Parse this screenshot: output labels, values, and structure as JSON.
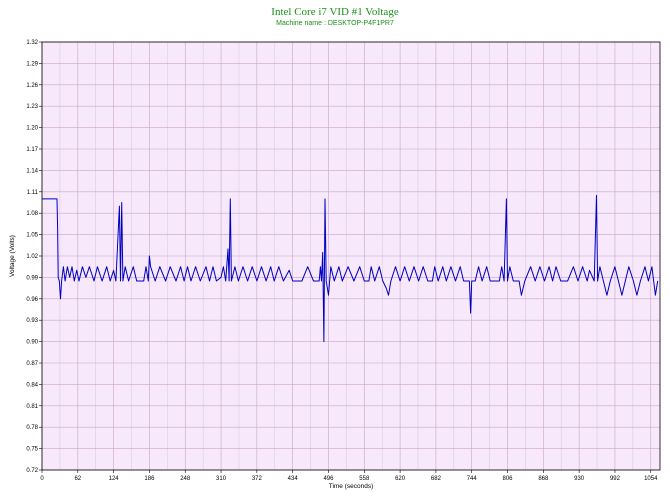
{
  "chart_data": {
    "type": "line",
    "title": "Intel Core i7 VID #1 Voltage",
    "subtitle": "Machine name : DESKTOP-P4F1PR7",
    "xlabel": "Time (seconds)",
    "ylabel": "Voltage (Volts)",
    "xlim": [
      0,
      1070
    ],
    "ylim": [
      0.72,
      1.32
    ],
    "x_ticks": [
      0,
      62,
      124,
      186,
      248,
      310,
      372,
      434,
      496,
      558,
      620,
      682,
      744,
      806,
      868,
      930,
      992,
      1054
    ],
    "y_ticks": [
      0.72,
      0.75,
      0.78,
      0.81,
      0.84,
      0.87,
      0.9,
      0.93,
      0.96,
      0.99,
      1.02,
      1.05,
      1.08,
      1.11,
      1.14,
      1.17,
      1.2,
      1.23,
      1.26,
      1.29,
      1.32
    ],
    "grid": true,
    "colors": {
      "line": "#0000c0",
      "plot_bg": "#f7e8fb",
      "grid": "#c9a6c9",
      "title": "#1a8f1a"
    },
    "series": [
      {
        "values": [
          [
            0,
            1.1
          ],
          [
            26,
            1.1
          ],
          [
            27,
            1.06
          ],
          [
            28,
            0.99
          ],
          [
            30,
            0.985
          ],
          [
            32,
            0.96
          ],
          [
            34,
            0.985
          ],
          [
            37,
            1.005
          ],
          [
            40,
            0.985
          ],
          [
            44,
            1.005
          ],
          [
            48,
            0.99
          ],
          [
            52,
            1.005
          ],
          [
            56,
            0.985
          ],
          [
            60,
            1.0
          ],
          [
            64,
            0.985
          ],
          [
            70,
            1.005
          ],
          [
            76,
            0.99
          ],
          [
            82,
            1.005
          ],
          [
            90,
            0.985
          ],
          [
            96,
            1.005
          ],
          [
            104,
            0.985
          ],
          [
            112,
            1.005
          ],
          [
            118,
            0.985
          ],
          [
            124,
            1.0
          ],
          [
            128,
            0.985
          ],
          [
            134,
            1.09
          ],
          [
            136,
            0.985
          ],
          [
            138,
            1.095
          ],
          [
            140,
            0.985
          ],
          [
            144,
            1.005
          ],
          [
            150,
            0.985
          ],
          [
            158,
            1.005
          ],
          [
            164,
            0.985
          ],
          [
            176,
            0.985
          ],
          [
            180,
            1.005
          ],
          [
            184,
            0.985
          ],
          [
            186,
            1.02
          ],
          [
            188,
            1.005
          ],
          [
            196,
            0.985
          ],
          [
            204,
            1.005
          ],
          [
            214,
            0.985
          ],
          [
            222,
            1.005
          ],
          [
            232,
            0.985
          ],
          [
            240,
            1.005
          ],
          [
            246,
            0.985
          ],
          [
            252,
            1.005
          ],
          [
            258,
            0.985
          ],
          [
            266,
            1.005
          ],
          [
            274,
            0.985
          ],
          [
            284,
            1.005
          ],
          [
            290,
            0.985
          ],
          [
            296,
            1.005
          ],
          [
            302,
            0.985
          ],
          [
            310,
            0.99
          ],
          [
            314,
            1.005
          ],
          [
            318,
            0.985
          ],
          [
            322,
            1.03
          ],
          [
            324,
            0.985
          ],
          [
            326,
            1.1
          ],
          [
            328,
            0.985
          ],
          [
            334,
            1.005
          ],
          [
            340,
            0.985
          ],
          [
            348,
            1.005
          ],
          [
            356,
            0.985
          ],
          [
            364,
            1.005
          ],
          [
            372,
            0.985
          ],
          [
            380,
            1.005
          ],
          [
            388,
            0.985
          ],
          [
            396,
            1.005
          ],
          [
            402,
            0.985
          ],
          [
            410,
            1.005
          ],
          [
            418,
            0.985
          ],
          [
            428,
            1.0
          ],
          [
            434,
            0.985
          ],
          [
            450,
            0.985
          ],
          [
            460,
            1.005
          ],
          [
            470,
            0.985
          ],
          [
            480,
            0.985
          ],
          [
            482,
            1.005
          ],
          [
            484,
            0.985
          ],
          [
            486,
            1.025
          ],
          [
            488,
            0.9
          ],
          [
            490,
            1.1
          ],
          [
            492,
            0.985
          ],
          [
            496,
            0.965
          ],
          [
            500,
            1.005
          ],
          [
            506,
            0.985
          ],
          [
            514,
            1.005
          ],
          [
            520,
            0.985
          ],
          [
            530,
            1.005
          ],
          [
            540,
            0.985
          ],
          [
            550,
            1.005
          ],
          [
            558,
            0.985
          ],
          [
            566,
            0.985
          ],
          [
            570,
            1.005
          ],
          [
            576,
            0.985
          ],
          [
            584,
            1.005
          ],
          [
            590,
            0.985
          ],
          [
            596,
            0.975
          ],
          [
            600,
            0.965
          ],
          [
            604,
            0.985
          ],
          [
            612,
            1.005
          ],
          [
            620,
            0.985
          ],
          [
            628,
            1.005
          ],
          [
            636,
            0.985
          ],
          [
            644,
            1.005
          ],
          [
            652,
            0.985
          ],
          [
            660,
            1.005
          ],
          [
            668,
            0.985
          ],
          [
            676,
            0.985
          ],
          [
            680,
            1.005
          ],
          [
            686,
            0.985
          ],
          [
            694,
            1.005
          ],
          [
            700,
            0.985
          ],
          [
            708,
            1.005
          ],
          [
            716,
            0.985
          ],
          [
            724,
            1.005
          ],
          [
            730,
            0.985
          ],
          [
            740,
            0.985
          ],
          [
            742,
            0.94
          ],
          [
            744,
            0.985
          ],
          [
            750,
            0.985
          ],
          [
            756,
            1.005
          ],
          [
            762,
            0.985
          ],
          [
            770,
            1.005
          ],
          [
            776,
            0.985
          ],
          [
            792,
            0.985
          ],
          [
            796,
            1.005
          ],
          [
            800,
            0.985
          ],
          [
            804,
            1.1
          ],
          [
            806,
            0.985
          ],
          [
            810,
            1.005
          ],
          [
            816,
            0.985
          ],
          [
            826,
            0.985
          ],
          [
            830,
            0.965
          ],
          [
            836,
            0.985
          ],
          [
            846,
            1.005
          ],
          [
            854,
            0.985
          ],
          [
            862,
            1.005
          ],
          [
            870,
            0.985
          ],
          [
            878,
            1.005
          ],
          [
            884,
            0.985
          ],
          [
            890,
            1.005
          ],
          [
            898,
            0.985
          ],
          [
            910,
            0.985
          ],
          [
            920,
            1.005
          ],
          [
            928,
            0.985
          ],
          [
            936,
            1.005
          ],
          [
            944,
            0.985
          ],
          [
            948,
            1.0
          ],
          [
            956,
            0.985
          ],
          [
            960,
            1.105
          ],
          [
            962,
            0.985
          ],
          [
            966,
            1.005
          ],
          [
            972,
            0.985
          ],
          [
            978,
            0.965
          ],
          [
            984,
            0.985
          ],
          [
            992,
            1.005
          ],
          [
            998,
            0.985
          ],
          [
            1004,
            0.965
          ],
          [
            1010,
            0.985
          ],
          [
            1016,
            1.005
          ],
          [
            1024,
            0.985
          ],
          [
            1030,
            0.965
          ],
          [
            1036,
            0.985
          ],
          [
            1044,
            1.005
          ],
          [
            1050,
            0.985
          ],
          [
            1056,
            1.005
          ],
          [
            1062,
            0.965
          ],
          [
            1066,
            0.985
          ]
        ]
      }
    ]
  }
}
